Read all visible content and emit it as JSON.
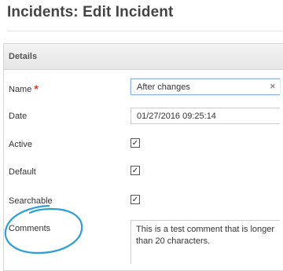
{
  "page": {
    "title": "Incidents: Edit Incident"
  },
  "panel": {
    "header": "Details"
  },
  "form": {
    "name": {
      "label": "Name",
      "required_marker": "*",
      "value": "After changes",
      "clear_icon": "×"
    },
    "date": {
      "label": "Date",
      "value": "01/27/2016 09:25:14"
    },
    "active": {
      "label": "Active",
      "checked": true,
      "mark": "✓"
    },
    "default": {
      "label": "Default",
      "checked": true,
      "mark": "✓"
    },
    "searchable": {
      "label": "Searchable",
      "checked": true,
      "mark": "✓"
    },
    "comments": {
      "label": "Comments",
      "value": "This is a test comment that is longer than 20 characters."
    }
  },
  "annotation": {
    "color": "#2b9fd6",
    "shape": "hand-drawn-circle"
  }
}
